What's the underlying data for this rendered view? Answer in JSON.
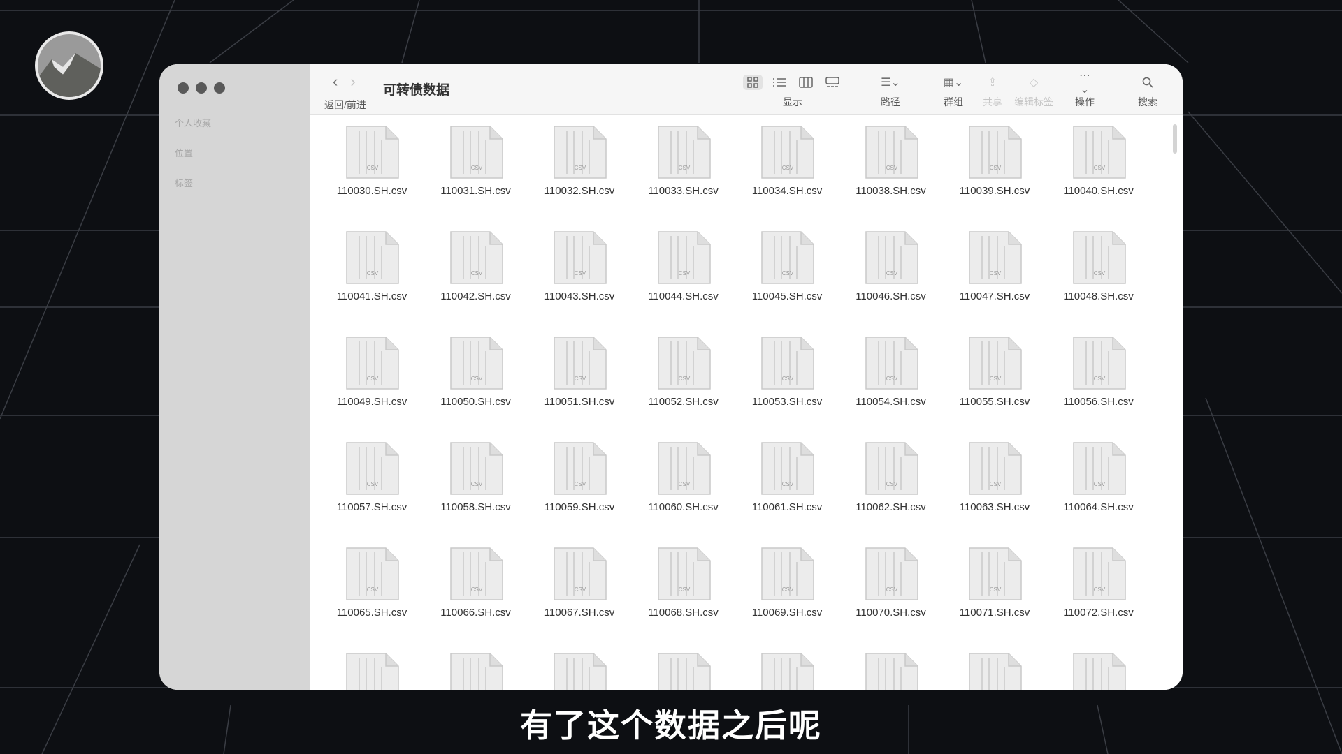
{
  "window": {
    "title": "可转债数据",
    "nav_label": "返回/前进"
  },
  "sidebar": {
    "sections": [
      "个人收藏",
      "位置",
      "标签"
    ]
  },
  "toolbar": {
    "view_label": "显示",
    "path_label": "路径",
    "group_label": "群组",
    "share_label": "共享",
    "tags_label": "编辑标签",
    "action_label": "操作",
    "search_label": "搜索"
  },
  "file_type_badge": "CSV",
  "files": [
    "110030.SH.csv",
    "110031.SH.csv",
    "110032.SH.csv",
    "110033.SH.csv",
    "110034.SH.csv",
    "110038.SH.csv",
    "110039.SH.csv",
    "110040.SH.csv",
    "110041.SH.csv",
    "110042.SH.csv",
    "110043.SH.csv",
    "110044.SH.csv",
    "110045.SH.csv",
    "110046.SH.csv",
    "110047.SH.csv",
    "110048.SH.csv",
    "110049.SH.csv",
    "110050.SH.csv",
    "110051.SH.csv",
    "110052.SH.csv",
    "110053.SH.csv",
    "110054.SH.csv",
    "110055.SH.csv",
    "110056.SH.csv",
    "110057.SH.csv",
    "110058.SH.csv",
    "110059.SH.csv",
    "110060.SH.csv",
    "110061.SH.csv",
    "110062.SH.csv",
    "110063.SH.csv",
    "110064.SH.csv",
    "110065.SH.csv",
    "110066.SH.csv",
    "110067.SH.csv",
    "110068.SH.csv",
    "110069.SH.csv",
    "110070.SH.csv",
    "110071.SH.csv",
    "110072.SH.csv"
  ],
  "partial_row_count": 8,
  "subtitle": "有了这个数据之后呢",
  "colors": {
    "background": "#0d0f13",
    "sidebar": "#d6d6d6",
    "content": "#ffffff"
  }
}
